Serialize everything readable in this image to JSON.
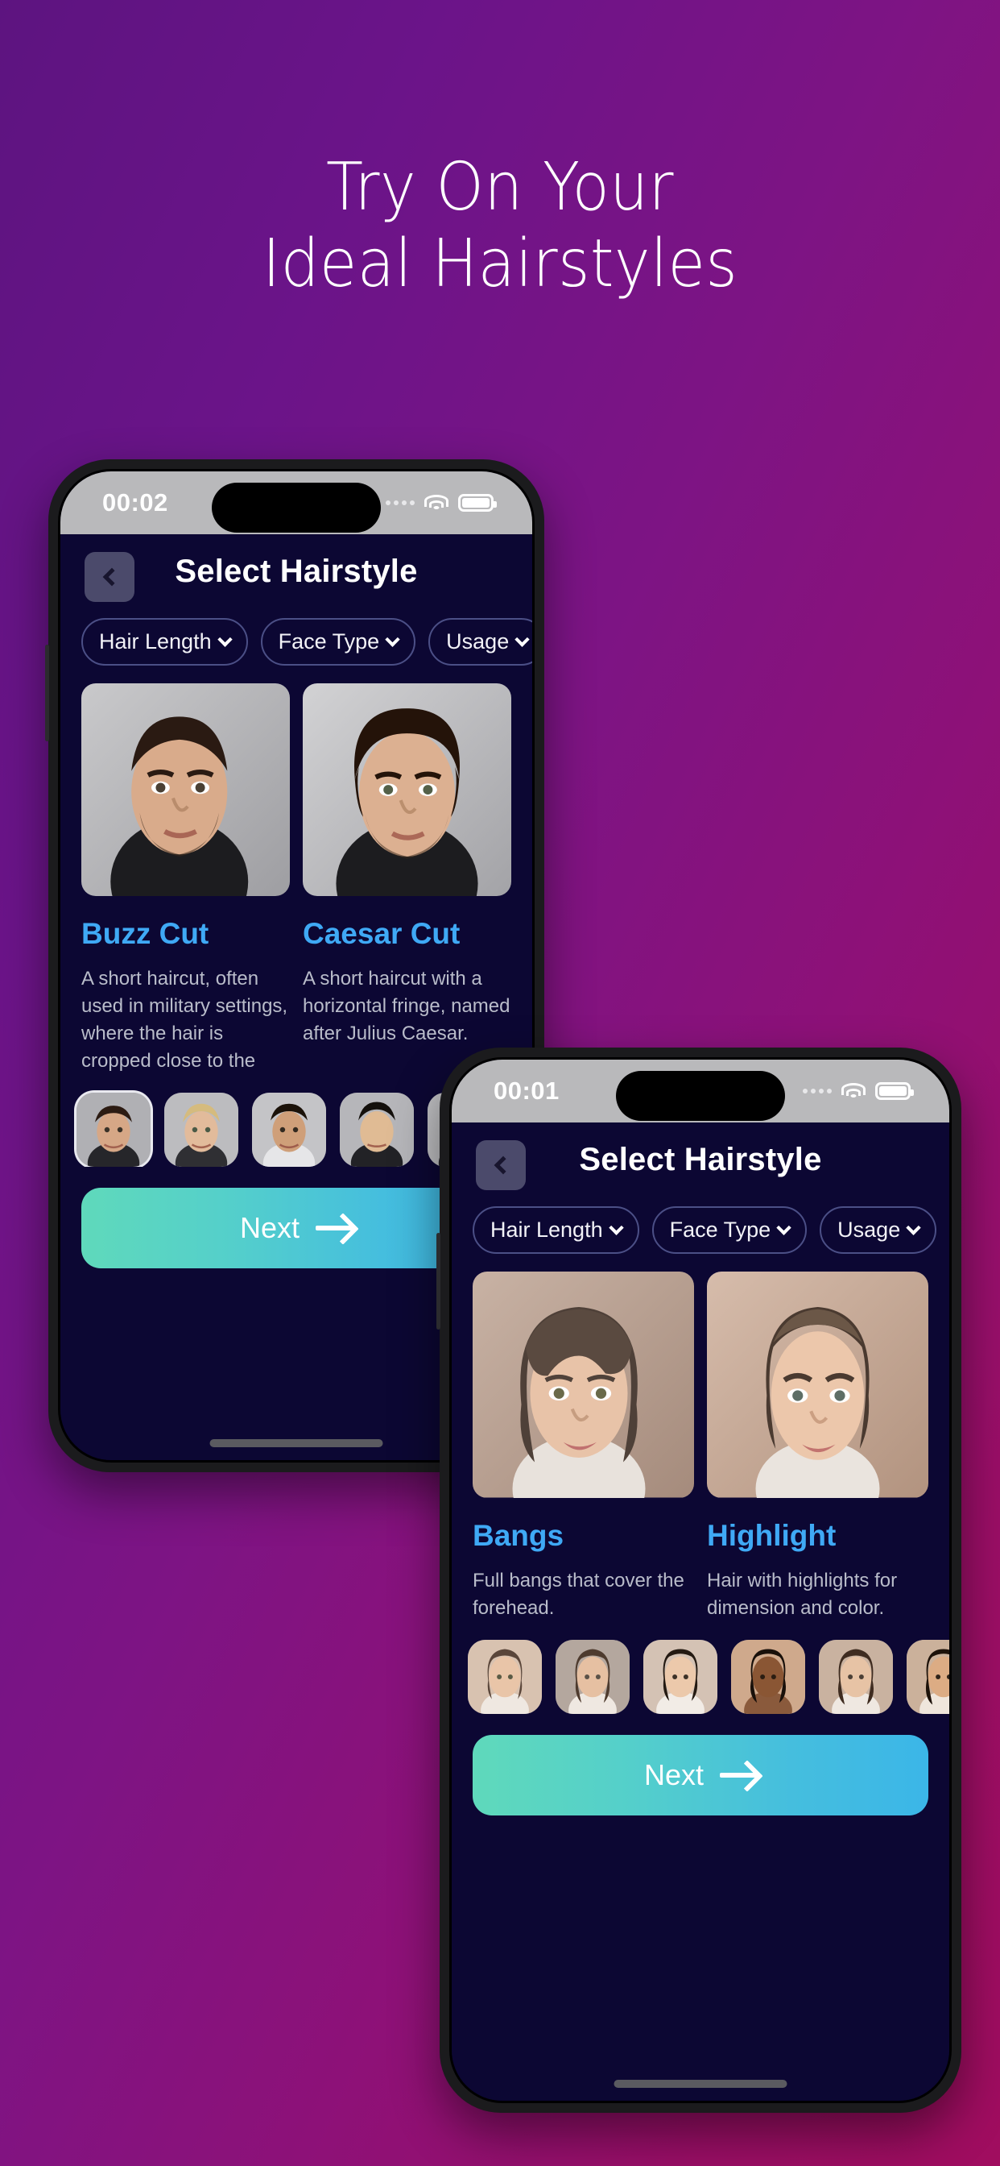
{
  "theme": {
    "bg_gradient_from": "#5d1480",
    "bg_gradient_to": "#a00d5f",
    "accent_blue": "#3fa9f5",
    "next_gradient_from": "#5fd9bb",
    "next_gradient_to": "#3bb6e8",
    "app_bg": "#0c0733"
  },
  "headline": {
    "line1": "Try On Your",
    "line2": "Ideal Hairstyles"
  },
  "phone_back": {
    "status": {
      "time": "00:02"
    },
    "nav": {
      "title": "Select Hairstyle",
      "back_label": "Back"
    },
    "filters": [
      {
        "label": "Hair Length"
      },
      {
        "label": "Face Type"
      },
      {
        "label": "Usage"
      }
    ],
    "cards": [
      {
        "title": "Buzz Cut",
        "desc": "A short haircut, often used in military settings, where the hair is cropped close to the"
      },
      {
        "title": "Caesar Cut",
        "desc": "A short haircut with a horizontal fringe, named after Julius Caesar."
      }
    ],
    "thumbnails": [
      {
        "name": "model-1",
        "selected": true
      },
      {
        "name": "model-2",
        "selected": false
      },
      {
        "name": "model-3",
        "selected": false
      },
      {
        "name": "model-4",
        "selected": false
      },
      {
        "name": "model-5",
        "selected": false
      }
    ],
    "next_label": "Next"
  },
  "phone_front": {
    "status": {
      "time": "00:01"
    },
    "nav": {
      "title": "Select Hairstyle",
      "back_label": "Back"
    },
    "filters": [
      {
        "label": "Hair Length"
      },
      {
        "label": "Face Type"
      },
      {
        "label": "Usage"
      }
    ],
    "cards": [
      {
        "title": "Bangs",
        "desc": "Full bangs that cover the forehead."
      },
      {
        "title": "Highlight",
        "desc": "Hair with highlights for dimension and color."
      }
    ],
    "thumbnails": [
      {
        "name": "model-1",
        "selected": false
      },
      {
        "name": "model-2",
        "selected": false
      },
      {
        "name": "model-3",
        "selected": false
      },
      {
        "name": "model-4",
        "selected": false
      },
      {
        "name": "model-5",
        "selected": false
      },
      {
        "name": "model-6",
        "selected": false
      }
    ],
    "next_label": "Next"
  }
}
